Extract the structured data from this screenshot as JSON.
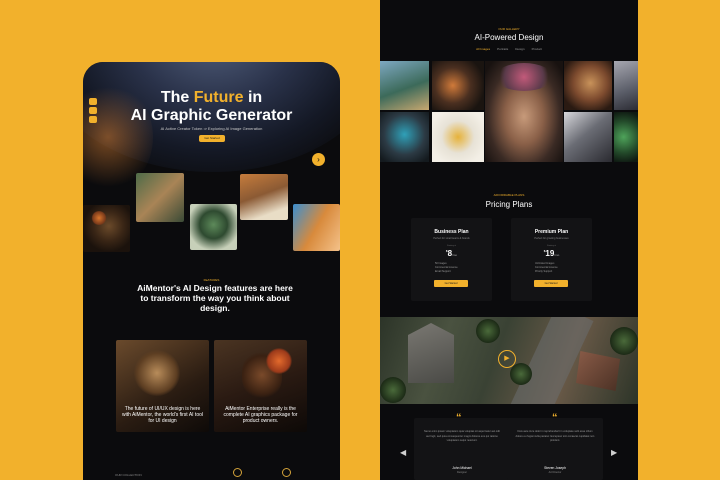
{
  "left": {
    "hero": {
      "title_part1": "The ",
      "title_accent": "Future",
      "title_part2": " in",
      "title_line2": "AI Graphic Generator",
      "subtitle": "AI Active Creator Token ⇒ Exploring AI Image Generation",
      "cta": "Get Started"
    },
    "features": {
      "label": "FEATURES",
      "text": "AiMentor's AI Design features are here to transform the way you think about design."
    },
    "cards": [
      {
        "caption": "The future of UI/UX design is here with AiMentor, the world's first AI tool for UI design"
      },
      {
        "caption": "AiMentor Enterprise really is the complete AI graphics package for product owners."
      }
    ],
    "footer_label": "OUR COLLECTION"
  },
  "right": {
    "top_label": "OUR GALLERY",
    "title": "AI-Powered Design",
    "tabs": [
      "All Images",
      "Portraits",
      "Design",
      "Product"
    ],
    "pricing": {
      "label": "AFFORDABLE PLANS",
      "title": "Pricing Plans",
      "plans": [
        {
          "name": "Business Plan",
          "desc": "Perfect for small teams & brands",
          "small": "Starting at",
          "currency": "$",
          "price": "8",
          "per": "/mo",
          "features": [
            "50 Images",
            "Commercial License",
            "Email Support"
          ],
          "button": "Get Started"
        },
        {
          "name": "Premium Plan",
          "desc": "Perfect for growing businesses",
          "small": "Starting at",
          "currency": "$",
          "price": "19",
          "per": "/mo",
          "features": [
            "Unlimited Images",
            "Commercial License",
            "Priority Support"
          ],
          "button": "Get Started"
        }
      ]
    },
    "testimonials": [
      {
        "text": "Nemo enim ipsam voluptatem quia voluptas sit aspernatur aut odit aut fugit, sed quia consequuntur magni dolores eos qui ratione voluptatem sequi nesciunt.",
        "name": "John Michael",
        "role": "Designer"
      },
      {
        "text": "Duis aute irure dolor in reprehenderit in voluptate velit esse cillum dolore eu fugiat nulla pariatur. Excepteur sint occaecat cupidatat non proident.",
        "name": "Steven Joseph",
        "role": "Art Director"
      }
    ]
  },
  "colors": {
    "accent": "#f2b12c",
    "background": "#0b0b0d"
  }
}
